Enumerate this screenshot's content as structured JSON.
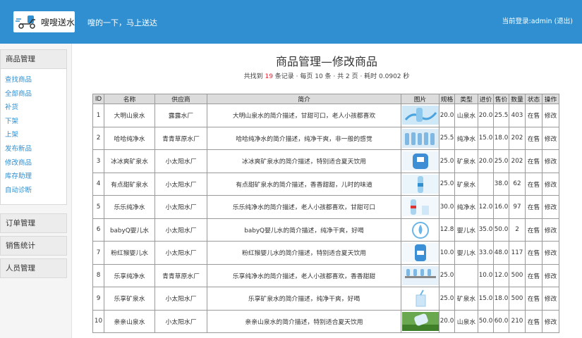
{
  "header": {
    "logo_text": "嗖嗖送水",
    "slogan": "嗖的一下，马上送达",
    "login_prefix": "当前登录:admin",
    "logout_label": "(退出)"
  },
  "sidebar": {
    "sections": [
      {
        "title": "商品管理",
        "items": [
          "查找商品",
          "全部商品",
          "补货",
          "下架",
          "上架",
          "发布新品",
          "修改商品",
          "库存助理",
          "自动诊断"
        ]
      },
      {
        "title": "订单管理"
      },
      {
        "title": "销售统计"
      },
      {
        "title": "人员管理"
      }
    ]
  },
  "main": {
    "title": "商品管理—修改商品",
    "stats": {
      "prefix": "共找到 ",
      "count": "19",
      "suffix": " 条记录 · 每页 10 条 · 共 2 页 · 耗时 0.0902 秒"
    },
    "columns": [
      "ID",
      "名称",
      "供应商",
      "简介",
      "图片",
      "规格",
      "类型",
      "进价",
      "售价",
      "数量",
      "状态",
      "操作"
    ],
    "rows": [
      {
        "id": "1",
        "name": "大明山泉水",
        "supplier": "露露水厂",
        "desc": "大明山泉水的简介描述，甘甜可口，老人小孩都喜欢",
        "image": "water-splash",
        "spec": "20.0",
        "type": "山泉水",
        "cost": "20.0",
        "price": "25.5",
        "qty": "403",
        "status": "在售",
        "action": "修改"
      },
      {
        "id": "2",
        "name": "哈哈纯净水",
        "supplier": "青青草原水厂",
        "desc": "哈哈纯净水的简介描述，纯净干爽，非一般的感觉",
        "image": "bottles-row",
        "spec": "25.5",
        "type": "纯净水",
        "cost": "15.0",
        "price": "18.0",
        "qty": "202",
        "status": "在售",
        "action": "修改"
      },
      {
        "id": "3",
        "name": "冰冰爽矿泉水",
        "supplier": "小太阳水厂",
        "desc": "冰冰爽矿泉水的简介描述，特别适合夏天饮用",
        "image": "water-jug",
        "spec": "25.0",
        "type": "矿泉水",
        "cost": "20.0",
        "price": "25.0",
        "qty": "202",
        "status": "在售",
        "action": "修改"
      },
      {
        "id": "4",
        "name": "有点甜矿泉水",
        "supplier": "小太阳水厂",
        "desc": "有点甜矿泉水的简介描述，香香甜甜，儿时的味道",
        "image": "single-bottle",
        "spec": "25.0",
        "type": "矿泉水",
        "cost": "",
        "price": "38.0",
        "qty": "62",
        "status": "在售",
        "action": "修改"
      },
      {
        "id": "5",
        "name": "乐乐纯净水",
        "supplier": "小太阳水厂",
        "desc": "乐乐纯净水的简介描述，老人小孩都喜欢，甘甜可口",
        "image": "bottle-glass",
        "spec": "30.0",
        "type": "纯净水",
        "cost": "12.0",
        "price": "16.0",
        "qty": "97",
        "status": "在售",
        "action": "修改"
      },
      {
        "id": "6",
        "name": "babyQ婴儿水",
        "supplier": "小太阳水厂",
        "desc": "babyQ婴儿水的简介描述，纯净干爽，好喝",
        "image": "water-drop",
        "spec": "12.8",
        "type": "婴儿水",
        "cost": "35.0",
        "price": "50.0",
        "qty": "2",
        "status": "在售",
        "action": "修改"
      },
      {
        "id": "7",
        "name": "粉红猴婴儿水",
        "supplier": "小太阳水厂",
        "desc": "粉红猴婴儿水的简介描述，特别适合夏天饮用",
        "image": "big-bottle",
        "spec": "10.0",
        "type": "婴儿水",
        "cost": "33.0",
        "price": "48.0",
        "qty": "117",
        "status": "在售",
        "action": "修改"
      },
      {
        "id": "8",
        "name": "乐享纯净水",
        "supplier": "青青草原水厂",
        "desc": "乐享纯净水的简介描述，老人小孩都喜欢，香香甜甜",
        "image": "bottle-factory",
        "spec": "25.0",
        "type": "",
        "cost": "10.0",
        "price": "12.0",
        "qty": "500",
        "status": "在售",
        "action": "修改"
      },
      {
        "id": "9",
        "name": "乐享矿泉水",
        "supplier": "小太阳水厂",
        "desc": "乐享矿泉水的简介描述，纯净干爽，好喝",
        "image": "glass-pour",
        "spec": "25.0",
        "type": "矿泉水",
        "cost": "15.0",
        "price": "18.0",
        "qty": "500",
        "status": "在售",
        "action": "修改"
      },
      {
        "id": "10",
        "name": "亲亲山泉水",
        "supplier": "小太阳水厂",
        "desc": "亲亲山泉水的简介描述，特别适合夏天饮用",
        "image": "bottle-grass",
        "spec": "20.0",
        "type": "山泉水",
        "cost": "50.0",
        "price": "60.0",
        "qty": "210",
        "status": "在售",
        "action": "修改"
      }
    ]
  }
}
